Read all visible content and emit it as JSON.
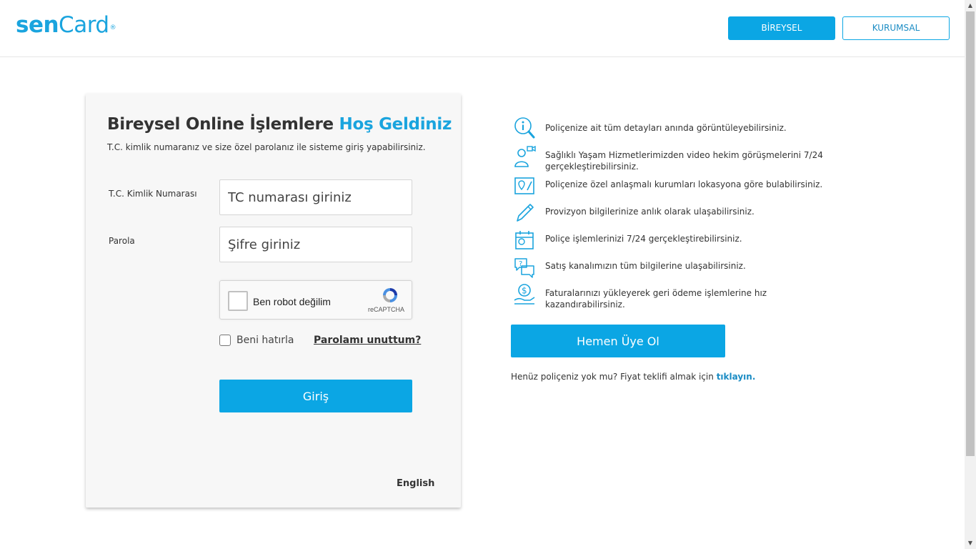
{
  "header": {
    "logo_bold": "sen",
    "logo_thin": "Card",
    "logo_mark": "®",
    "btn_individual": "BİREYSEL",
    "btn_corporate": "KURUMSAL"
  },
  "login": {
    "title_main": "Bireysel Online İşlemlere",
    "title_accent": "Hoş Geldiniz",
    "subtitle": "T.C. kimlik numaranız ve size özel parolanız ile sisteme giriş yapabilirsiniz.",
    "tc_label": "T.C. Kimlik Numarası",
    "tc_placeholder": "TC numarası giriniz",
    "password_label": "Parola",
    "password_placeholder": "Şifre giriniz",
    "captcha_label": "Ben robot değilim",
    "captcha_brand": "reCAPTCHA",
    "remember_label": "Beni hatırla",
    "forgot_link": "Parolamı unuttum?",
    "submit_label": "Giriş",
    "language_link": "English"
  },
  "features": [
    {
      "icon": "magnifier-info-icon",
      "text": "Poliçenize ait tüm detayları anında görüntüleyebilirsiniz."
    },
    {
      "icon": "doctor-video-icon",
      "text": "Sağlıklı Yaşam Hizmetlerimizden video hekim görüşmelerini 7/24 gerçekleştirebilirsiniz."
    },
    {
      "icon": "location-map-icon",
      "text": "Poliçenize özel anlaşmalı kurumları lokasyona göre bulabilirsiniz."
    },
    {
      "icon": "pen-icon",
      "text": "Provizyon bilgilerinize anlık olarak ulaşabilirsiniz."
    },
    {
      "icon": "policy-calendar-icon",
      "text": "Poliçe işlemlerinizi 7/24 gerçekleştirebilirsiniz."
    },
    {
      "icon": "chat-question-icon",
      "text": "Satış kanalımızın tüm bilgilerine ulaşabilirsiniz."
    },
    {
      "icon": "hand-money-icon",
      "text": "Faturalarınızı yükleyerek geri ödeme işlemlerine hız kazandırabilirsiniz."
    }
  ],
  "signup_label": "Hemen Üye Ol",
  "quote": {
    "text": "Henüz poliçeniz yok mu? Fiyat teklifi almak için",
    "link": "tıklayın."
  },
  "colors": {
    "brand": "#0ba6e4",
    "accent_text": "#1aa4de",
    "link": "#1b8cc4"
  }
}
